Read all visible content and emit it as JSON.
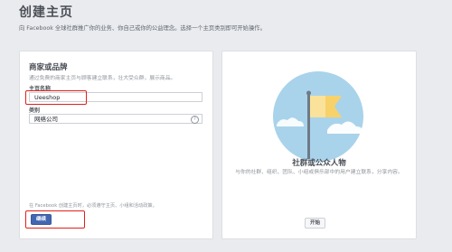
{
  "page": {
    "title": "创建主页",
    "subtitle": "向 Facebook 全球社群推广你的业务、你自己或你的公益理念。选择一个主页类别即可开始操作。"
  },
  "business_card": {
    "title": "商家或品牌",
    "description": "通过免费的商家主页与顾客建立联系，壮大受众群，展示商品。",
    "page_name_label": "主页名称",
    "page_name_value": "Ueeshop",
    "category_label": "类别",
    "category_value": "网络公司",
    "help_icon": "question-circle-icon",
    "note_prefix": "在 Facebook 创建主页时，必须遵守主页、小组和活动政策。",
    "continue_label": "继续"
  },
  "community_card": {
    "title": "社群或公众人物",
    "description": "与你的社群、组织、团队、小组或俱乐部中的用户建立联系，分享内容。",
    "start_label": "开始"
  },
  "colors": {
    "accent": "#4267b2",
    "highlight": "#e0201b",
    "illustration_circle": "#9ccbe6",
    "flag": "#f7d26b"
  }
}
